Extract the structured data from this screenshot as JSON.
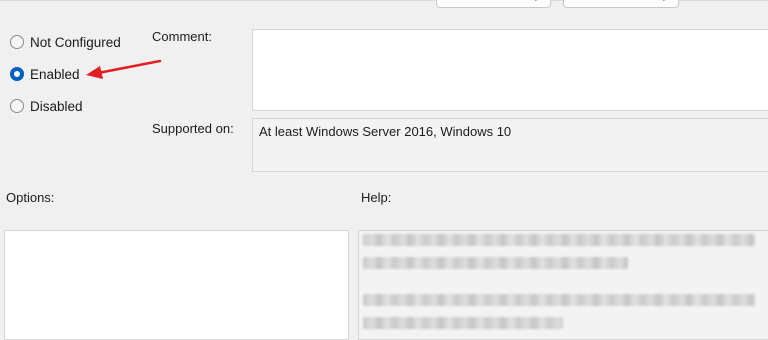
{
  "state": {
    "options": [
      {
        "label": "Not Configured",
        "selected": false
      },
      {
        "label": "Enabled",
        "selected": true
      },
      {
        "label": "Disabled",
        "selected": false
      }
    ]
  },
  "comment": {
    "label": "Comment:",
    "value": ""
  },
  "supported_on": {
    "label": "Supported on:",
    "value": "At least Windows Server 2016, Windows 10"
  },
  "options_panel": {
    "label": "Options:"
  },
  "help_panel": {
    "label": "Help:"
  },
  "colors": {
    "accent": "#0060c0",
    "annotation_arrow": "#e02020",
    "background": "#f0f0f0"
  }
}
